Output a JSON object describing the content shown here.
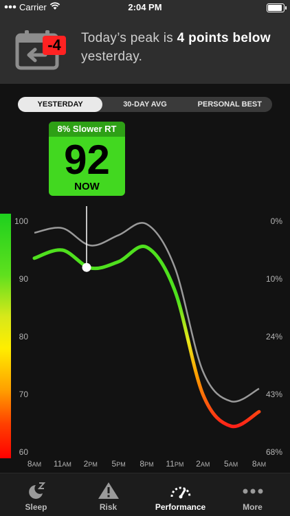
{
  "status_bar": {
    "carrier": "Carrier",
    "time": "2:04 PM"
  },
  "banner": {
    "badge": "-4",
    "text_prefix": "Today’s peak is ",
    "text_bold": "4 points below",
    "text_suffix": " yesterday."
  },
  "segments": [
    {
      "label": "YESTERDAY",
      "active": true
    },
    {
      "label": "30-DAY AVG",
      "active": false
    },
    {
      "label": "PERSONAL BEST",
      "active": false
    }
  ],
  "callout": {
    "header": "8% Slower RT",
    "value": "92",
    "label": "NOW"
  },
  "colors": {
    "green": "#42d820",
    "dark_green": "#2ea016",
    "badge_red": "#ff2222",
    "background": "#121212"
  },
  "chart_data": {
    "type": "line",
    "x": [
      "8AM",
      "11AM",
      "2PM",
      "5PM",
      "8PM",
      "11PM",
      "2AM",
      "5AM",
      "8AM"
    ],
    "y_left_ticks": [
      "100",
      "90",
      "80",
      "70",
      "60"
    ],
    "y_right_ticks": [
      "0%",
      "10%",
      "24%",
      "43%",
      "68%"
    ],
    "ylim": [
      60,
      100
    ],
    "series": [
      {
        "values": [
          98.0,
          98.8,
          95.8,
          97.6,
          99.5,
          92.0,
          74.0,
          68.8,
          71.0
        ],
        "color": "#9a9a9a"
      },
      {
        "values": [
          93.6,
          95.0,
          91.9,
          93.0,
          95.5,
          88.0,
          70.0,
          64.5,
          67.0
        ],
        "color": "gradient"
      }
    ],
    "current_value": 92
  },
  "tabs": [
    {
      "label": "Sleep",
      "icon": "sleep-moon-icon",
      "active": false
    },
    {
      "label": "Risk",
      "icon": "warning-icon",
      "active": false
    },
    {
      "label": "Performance",
      "icon": "gauge-icon",
      "active": true
    },
    {
      "label": "More",
      "icon": "more-dots-icon",
      "active": false
    }
  ]
}
